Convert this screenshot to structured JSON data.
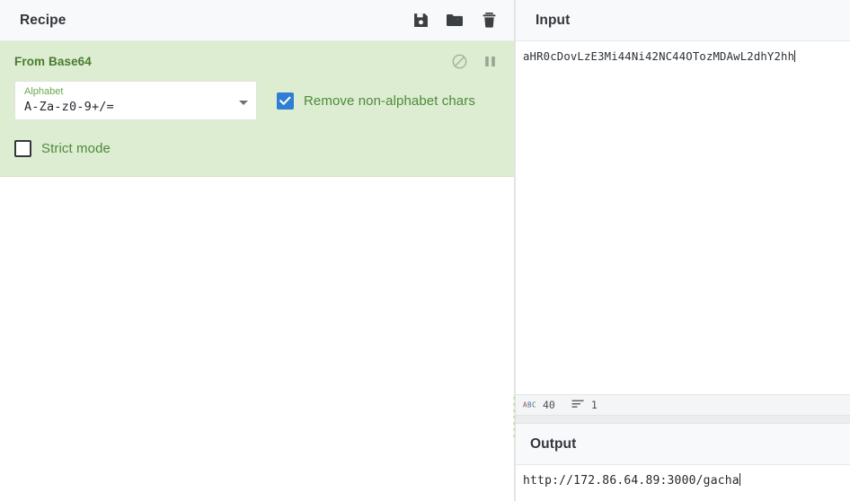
{
  "recipe": {
    "title": "Recipe",
    "actions": [
      {
        "name": "save-recipe-button",
        "icon": "save-icon",
        "label": "Save recipe"
      },
      {
        "name": "load-recipe-button",
        "icon": "folder-icon",
        "label": "Load recipe"
      },
      {
        "name": "clear-recipe-button",
        "icon": "trash-icon",
        "label": "Clear recipe"
      }
    ],
    "operations": [
      {
        "name": "From Base64",
        "icons": [
          {
            "name": "disable-operation-icon",
            "glyph": "circle-slash"
          },
          {
            "name": "breakpoint-operation-icon",
            "glyph": "pause"
          }
        ],
        "args": {
          "alphabet_label": "Alphabet",
          "alphabet_value": "A-Za-z0-9+/=",
          "remove_non_alphabet_label": "Remove non-alphabet chars",
          "remove_non_alphabet_checked": "true",
          "strict_mode_label": "Strict mode",
          "strict_mode_checked": "false"
        }
      }
    ]
  },
  "input": {
    "title": "Input",
    "value": "aHR0cDovLzE3Mi44Ni42NC44OTozMDAwL2dhY2hh",
    "status": {
      "length_icon": "abc-icon",
      "length": "40",
      "lines_icon": "lines-icon",
      "lines": "1"
    }
  },
  "output": {
    "title": "Output",
    "value": "http://172.86.64.89:3000/gacha"
  },
  "colors": {
    "operation_bg": "#dcedd2",
    "operation_title": "#4a7c2f",
    "checkbox_accent": "#2e7fd4",
    "panel_header_bg": "#f8f9fa"
  }
}
